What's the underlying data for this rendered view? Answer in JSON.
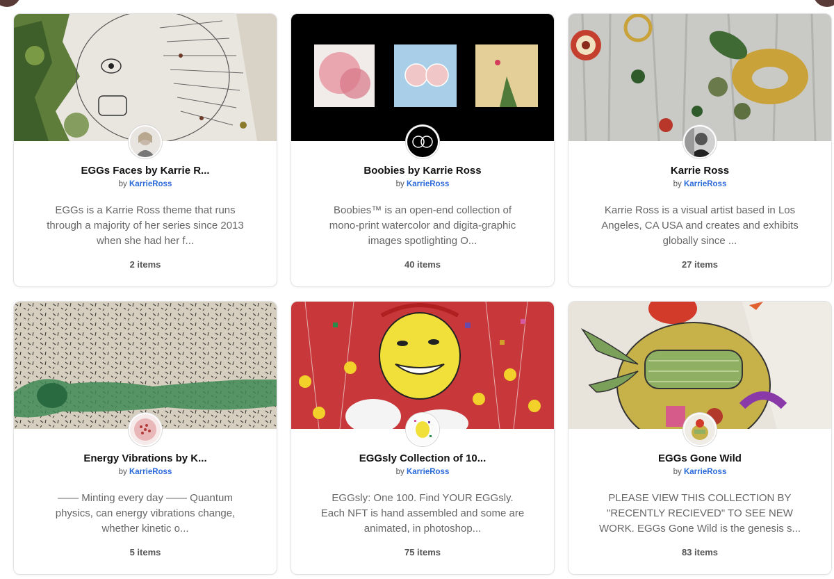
{
  "collections": [
    {
      "title": "EGGs Faces by Karrie R...",
      "by_prefix": "by",
      "author": "KarrieRoss",
      "description": "EGGs is a Karrie Ross theme that runs through a majority of her series since 2013 when she had her f...",
      "count": "2 items",
      "banner_icon": "line-drawing-face-image",
      "avatar_icon": "artist-portrait-avatar"
    },
    {
      "title": "Boobies by Karrie Ross",
      "by_prefix": "by",
      "author": "KarrieRoss",
      "description": "Boobies™ is an open-end collection of mono-print watercolor and digita-graphic images spotlighting O...",
      "count": "40 items",
      "banner_icon": "three-watercolor-prints-image",
      "avatar_icon": "boobies-logo-avatar"
    },
    {
      "title": "Karrie Ross",
      "by_prefix": "by",
      "author": "KarrieRoss",
      "description": "Karrie Ross is a visual artist based in Los Angeles, CA USA and creates and exhibits globally since ...",
      "count": "27 items",
      "banner_icon": "abstract-gold-circles-image",
      "avatar_icon": "artist-bw-portrait-avatar"
    },
    {
      "title": "Energy Vibrations by K...",
      "by_prefix": "by",
      "author": "KarrieRoss",
      "description": "—— Minting every day —— Quantum physics, can energy vibrations change, whether kinetic o...",
      "count": "5 items",
      "banner_icon": "green-stroke-dashes-image",
      "avatar_icon": "dot-pattern-avatar"
    },
    {
      "title": "EGGsly Collection of 10...",
      "by_prefix": "by",
      "author": "KarrieRoss",
      "description": "EGGsly: One 100. Find YOUR EGGsly. Each NFT is hand assembled and some are animated, in photoshop...",
      "count": "75 items",
      "banner_icon": "yellow-egg-ducks-image",
      "avatar_icon": "eggsly-avatar"
    },
    {
      "title": "EGGs Gone Wild",
      "by_prefix": "by",
      "author": "KarrieRoss",
      "description": "PLEASE VIEW THIS COLLECTION BY \"RECENTLY RECIEVED\" TO SEE NEW WORK. EGGs Gone Wild is the genesis s...",
      "count": "83 items",
      "banner_icon": "egg-figure-painting-image",
      "avatar_icon": "egg-figure-avatar"
    }
  ],
  "colors": {
    "author_link": "#2a6ad8",
    "title": "#111111",
    "description": "#666666",
    "card_border": "#e3e3e6"
  }
}
